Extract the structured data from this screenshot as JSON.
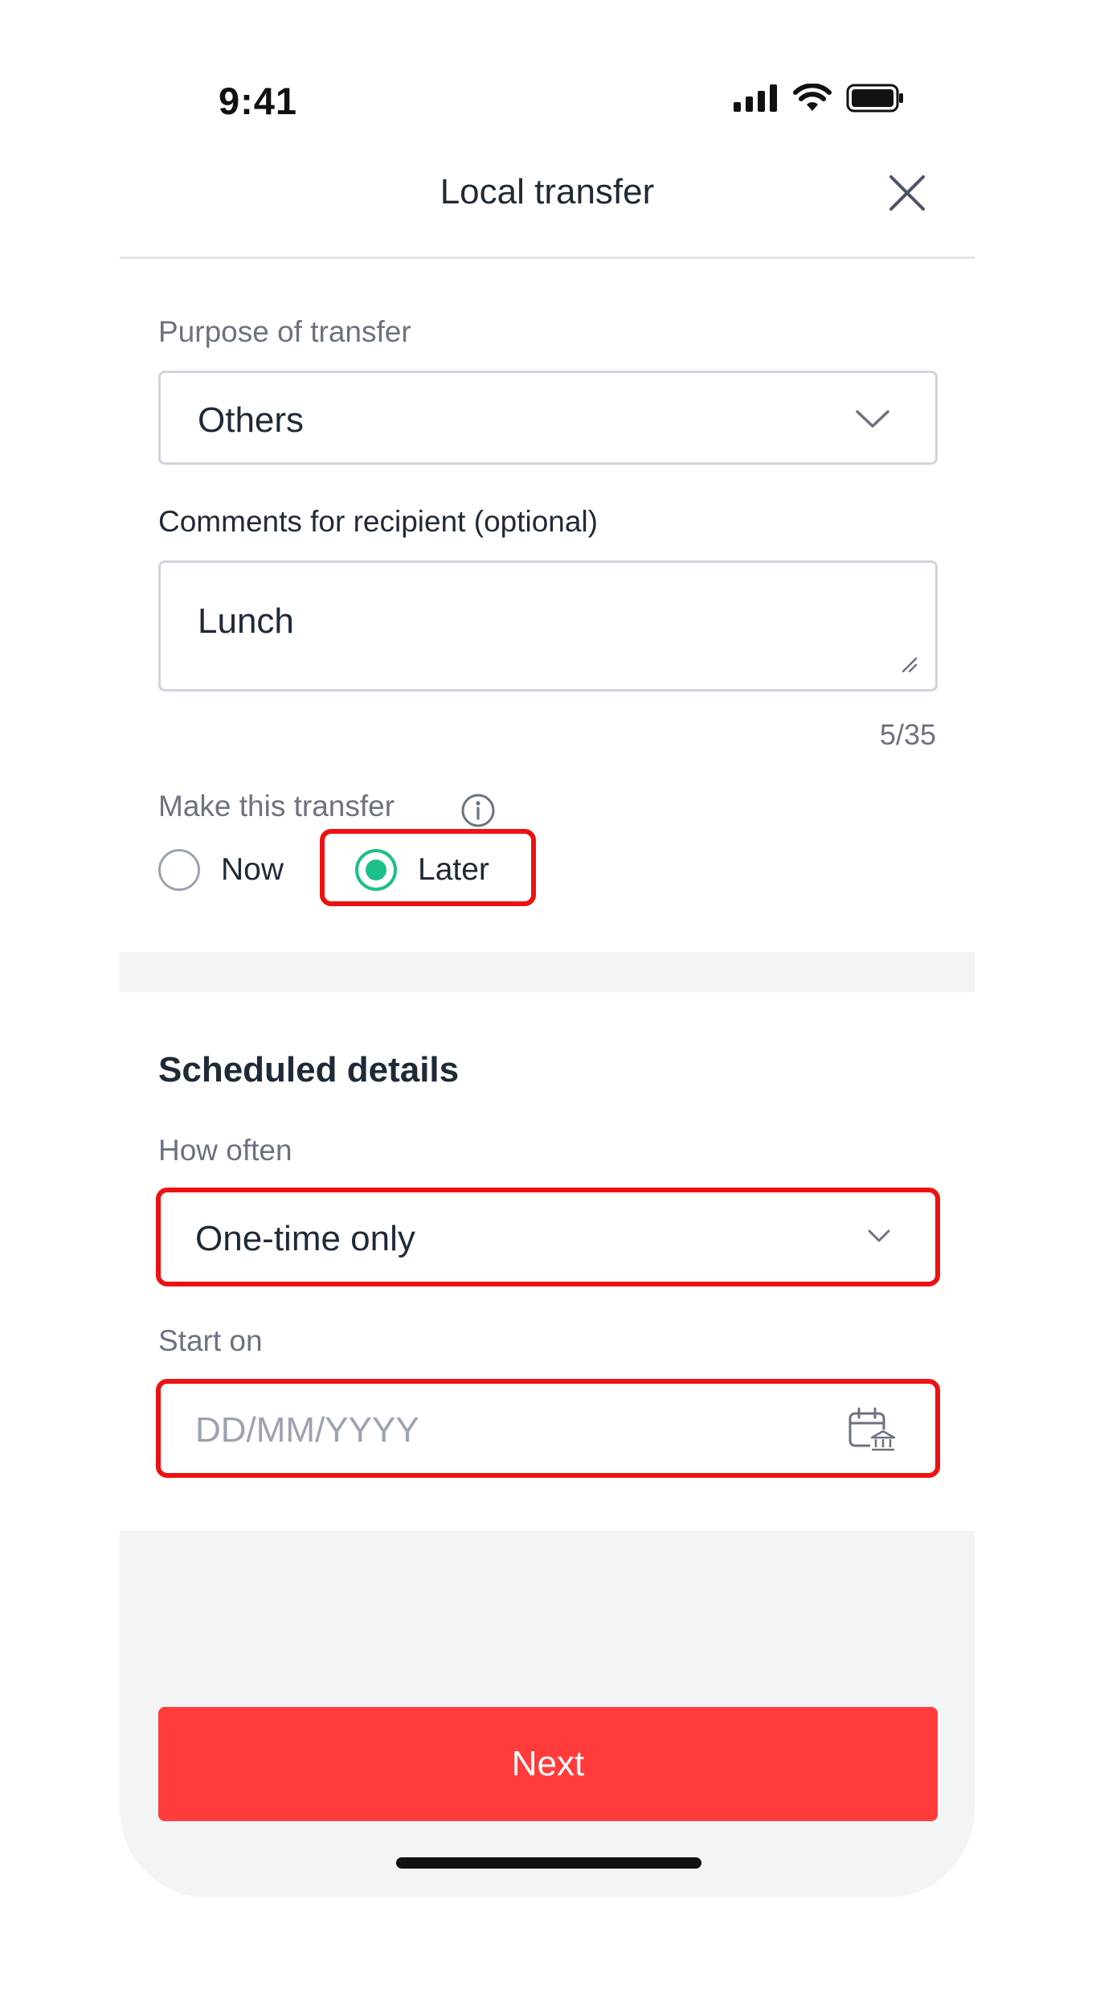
{
  "status_bar": {
    "time": "9:41",
    "icons": [
      "signal-icon",
      "wifi-icon",
      "battery-icon"
    ]
  },
  "header": {
    "title": "Local transfer",
    "close_icon": "close-icon"
  },
  "purpose": {
    "label": "Purpose of transfer",
    "value": "Others"
  },
  "comments": {
    "label": "Comments for recipient (optional)",
    "value": "Lunch",
    "counter": "5/35"
  },
  "timing": {
    "label": "Make this transfer",
    "options": [
      {
        "label": "Now",
        "selected": false
      },
      {
        "label": "Later",
        "selected": true
      }
    ]
  },
  "schedule": {
    "title": "Scheduled details",
    "frequency_label": "How often",
    "frequency_value": "One-time only",
    "start_label": "Start on",
    "start_placeholder": "DD/MM/YYYY"
  },
  "footer": {
    "next_label": "Next"
  },
  "colors": {
    "accent": "#1dbf8a",
    "primary_button": "#ff3b3b",
    "highlight": "#ee1111"
  }
}
